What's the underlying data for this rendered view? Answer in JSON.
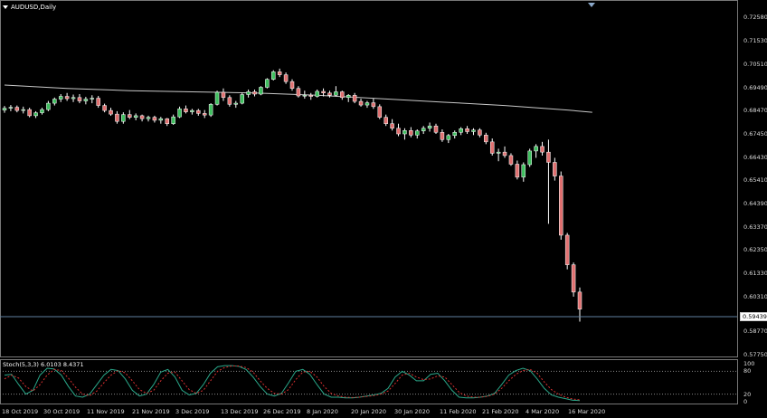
{
  "window": {
    "title": "AUDUSD,Daily"
  },
  "indicator": {
    "label": "Stoch(5,3,3) 6.0103 8.4371"
  },
  "price_axis": [
    "0.72580",
    "0.71530",
    "0.70510",
    "0.69490",
    "0.68470",
    "0.67450",
    "0.66430",
    "0.65410",
    "0.64390",
    "0.63370",
    "0.62350",
    "0.61330",
    "0.60310",
    "0.58770",
    "0.57750"
  ],
  "current_price": "0.59439",
  "osc_axis": [
    "100",
    "80",
    "20",
    "0"
  ],
  "date_axis": [
    "18 Oct 2019",
    "30 Oct 2019",
    "11 Nov 2019",
    "21 Nov 2019",
    "3 Dec 2019",
    "13 Dec 2019",
    "26 Dec 2019",
    "8 Jan 2020",
    "20 Jan 2020",
    "30 Jan 2020",
    "11 Feb 2020",
    "21 Feb 2020",
    "4 Mar 2020",
    "16 Mar 2020"
  ],
  "colors": {
    "background": "#000000",
    "bull": "#3fbf5f",
    "bear": "#e07070",
    "ma": "#c8c8c8",
    "stoch_main": "#2aa88a",
    "stoch_signal": "#d83030",
    "price_line": "#6080a0"
  },
  "chart_data": {
    "type": "candlestick",
    "symbol": "AUDUSD",
    "timeframe": "Daily",
    "ylim": [
      0.5775,
      0.7258
    ],
    "candles": [
      [
        0.685,
        0.6868,
        0.6838,
        0.6858
      ],
      [
        0.6858,
        0.6872,
        0.6845,
        0.6862
      ],
      [
        0.6862,
        0.687,
        0.684,
        0.6848
      ],
      [
        0.6848,
        0.6865,
        0.6835,
        0.6852
      ],
      [
        0.6852,
        0.686,
        0.6818,
        0.6825
      ],
      [
        0.6825,
        0.6845,
        0.6815,
        0.6838
      ],
      [
        0.6838,
        0.686,
        0.683,
        0.6852
      ],
      [
        0.6852,
        0.689,
        0.6845,
        0.688
      ],
      [
        0.688,
        0.6905,
        0.687,
        0.6898
      ],
      [
        0.6898,
        0.692,
        0.6885,
        0.691
      ],
      [
        0.691,
        0.6925,
        0.689,
        0.69
      ],
      [
        0.69,
        0.6918,
        0.6885,
        0.6905
      ],
      [
        0.6905,
        0.692,
        0.688,
        0.689
      ],
      [
        0.689,
        0.6908,
        0.6875,
        0.6898
      ],
      [
        0.6898,
        0.6915,
        0.688,
        0.6902
      ],
      [
        0.6902,
        0.6912,
        0.686,
        0.687
      ],
      [
        0.687,
        0.6878,
        0.684,
        0.6848
      ],
      [
        0.6848,
        0.686,
        0.6825,
        0.6832
      ],
      [
        0.6832,
        0.6845,
        0.679,
        0.68
      ],
      [
        0.68,
        0.684,
        0.679,
        0.683
      ],
      [
        0.683,
        0.685,
        0.681,
        0.6818
      ],
      [
        0.6818,
        0.6835,
        0.6805,
        0.6825
      ],
      [
        0.6825,
        0.683,
        0.68,
        0.6812
      ],
      [
        0.6812,
        0.6825,
        0.68,
        0.6818
      ],
      [
        0.6818,
        0.6825,
        0.6795,
        0.6805
      ],
      [
        0.6805,
        0.682,
        0.679,
        0.6812
      ],
      [
        0.6812,
        0.6815,
        0.678,
        0.679
      ],
      [
        0.679,
        0.683,
        0.6785,
        0.682
      ],
      [
        0.682,
        0.6865,
        0.6815,
        0.6855
      ],
      [
        0.6855,
        0.687,
        0.6835,
        0.6842
      ],
      [
        0.6842,
        0.6855,
        0.683,
        0.6848
      ],
      [
        0.6848,
        0.6855,
        0.6825,
        0.6835
      ],
      [
        0.6835,
        0.685,
        0.6815,
        0.6828
      ],
      [
        0.6828,
        0.688,
        0.682,
        0.6875
      ],
      [
        0.6875,
        0.6935,
        0.687,
        0.6928
      ],
      [
        0.6928,
        0.6945,
        0.689,
        0.6905
      ],
      [
        0.6905,
        0.6915,
        0.6865,
        0.6875
      ],
      [
        0.6875,
        0.689,
        0.686,
        0.688
      ],
      [
        0.688,
        0.6925,
        0.6875,
        0.6918
      ],
      [
        0.6918,
        0.694,
        0.6905,
        0.693
      ],
      [
        0.693,
        0.694,
        0.691,
        0.692
      ],
      [
        0.692,
        0.6955,
        0.6915,
        0.695
      ],
      [
        0.695,
        0.699,
        0.6945,
        0.6985
      ],
      [
        0.6985,
        0.7025,
        0.698,
        0.7018
      ],
      [
        0.7018,
        0.7032,
        0.6995,
        0.7005
      ],
      [
        0.7005,
        0.7015,
        0.6965,
        0.6975
      ],
      [
        0.6975,
        0.6985,
        0.6935,
        0.6945
      ],
      [
        0.6945,
        0.6955,
        0.6905,
        0.6912
      ],
      [
        0.6912,
        0.6935,
        0.69,
        0.6915
      ],
      [
        0.6915,
        0.6925,
        0.6895,
        0.691
      ],
      [
        0.691,
        0.694,
        0.6905,
        0.6932
      ],
      [
        0.6932,
        0.6945,
        0.691,
        0.6925
      ],
      [
        0.6925,
        0.6935,
        0.6905,
        0.6915
      ],
      [
        0.6915,
        0.6955,
        0.691,
        0.693
      ],
      [
        0.693,
        0.6935,
        0.6895,
        0.6905
      ],
      [
        0.6905,
        0.692,
        0.6885,
        0.6915
      ],
      [
        0.6915,
        0.6925,
        0.688,
        0.6888
      ],
      [
        0.6888,
        0.69,
        0.6865,
        0.6872
      ],
      [
        0.6872,
        0.689,
        0.686,
        0.6882
      ],
      [
        0.6882,
        0.69,
        0.6855,
        0.6865
      ],
      [
        0.6865,
        0.6875,
        0.681,
        0.6818
      ],
      [
        0.6818,
        0.683,
        0.678,
        0.679
      ],
      [
        0.679,
        0.681,
        0.676,
        0.677
      ],
      [
        0.677,
        0.679,
        0.6735,
        0.6745
      ],
      [
        0.6745,
        0.677,
        0.672,
        0.676
      ],
      [
        0.676,
        0.6775,
        0.673,
        0.674
      ],
      [
        0.674,
        0.6765,
        0.6725,
        0.6758
      ],
      [
        0.6758,
        0.678,
        0.6745,
        0.677
      ],
      [
        0.677,
        0.6795,
        0.6755,
        0.678
      ],
      [
        0.678,
        0.679,
        0.6745,
        0.6752
      ],
      [
        0.6752,
        0.6765,
        0.671,
        0.672
      ],
      [
        0.672,
        0.6745,
        0.6705,
        0.6738
      ],
      [
        0.6738,
        0.676,
        0.6725,
        0.6752
      ],
      [
        0.6752,
        0.6775,
        0.674,
        0.6768
      ],
      [
        0.6768,
        0.678,
        0.6745,
        0.6755
      ],
      [
        0.6755,
        0.677,
        0.674,
        0.6762
      ],
      [
        0.6762,
        0.677,
        0.673,
        0.674
      ],
      [
        0.674,
        0.675,
        0.67,
        0.671
      ],
      [
        0.671,
        0.6725,
        0.665,
        0.666
      ],
      [
        0.666,
        0.668,
        0.6625,
        0.6665
      ],
      [
        0.6665,
        0.669,
        0.664,
        0.665
      ],
      [
        0.665,
        0.666,
        0.6605,
        0.6612
      ],
      [
        0.6612,
        0.6628,
        0.6545,
        0.6555
      ],
      [
        0.6555,
        0.662,
        0.6535,
        0.661
      ],
      [
        0.661,
        0.668,
        0.66,
        0.667
      ],
      [
        0.667,
        0.67,
        0.664,
        0.669
      ],
      [
        0.669,
        0.671,
        0.665,
        0.6665
      ],
      [
        0.6665,
        0.672,
        0.635,
        0.662
      ],
      [
        0.662,
        0.664,
        0.654,
        0.656
      ],
      [
        0.656,
        0.658,
        0.628,
        0.63
      ],
      [
        0.63,
        0.631,
        0.615,
        0.617
      ],
      [
        0.617,
        0.618,
        0.603,
        0.605
      ],
      [
        0.605,
        0.607,
        0.592,
        0.5975
      ]
    ],
    "moving_average": [
      [
        0,
        0.696
      ],
      [
        10,
        0.6945
      ],
      [
        20,
        0.6935
      ],
      [
        30,
        0.693
      ],
      [
        40,
        0.6925
      ],
      [
        50,
        0.6915
      ],
      [
        60,
        0.69
      ],
      [
        70,
        0.6885
      ],
      [
        80,
        0.687
      ],
      [
        90,
        0.685
      ],
      [
        94,
        0.684
      ]
    ],
    "stochastic": {
      "label": "Stoch(5,3,3)",
      "main": [
        70,
        72,
        45,
        20,
        30,
        70,
        88,
        86,
        70,
        40,
        15,
        12,
        20,
        45,
        70,
        85,
        82,
        60,
        30,
        15,
        20,
        45,
        78,
        85,
        65,
        30,
        18,
        22,
        45,
        75,
        92,
        95,
        95,
        93,
        85,
        65,
        40,
        20,
        15,
        22,
        50,
        80,
        85,
        72,
        45,
        20,
        12,
        12,
        10,
        10,
        12,
        15,
        18,
        22,
        35,
        65,
        80,
        70,
        55,
        55,
        72,
        75,
        55,
        30,
        12,
        10,
        10,
        12,
        15,
        22,
        45,
        70,
        82,
        88,
        82,
        60,
        35,
        18,
        12,
        8,
        4,
        3
      ],
      "signal": [
        60,
        70,
        62,
        40,
        28,
        45,
        70,
        85,
        82,
        62,
        38,
        20,
        16,
        28,
        50,
        70,
        82,
        76,
        55,
        32,
        22,
        30,
        55,
        75,
        78,
        55,
        32,
        22,
        30,
        55,
        80,
        90,
        94,
        94,
        90,
        78,
        55,
        35,
        22,
        20,
        32,
        58,
        78,
        80,
        65,
        40,
        22,
        15,
        12,
        11,
        12,
        14,
        16,
        20,
        28,
        48,
        70,
        75,
        65,
        58,
        60,
        68,
        65,
        45,
        25,
        15,
        12,
        12,
        14,
        20,
        35,
        55,
        72,
        82,
        85,
        75,
        52,
        32,
        20,
        12,
        7,
        5
      ],
      "levels": [
        80,
        20
      ]
    }
  }
}
